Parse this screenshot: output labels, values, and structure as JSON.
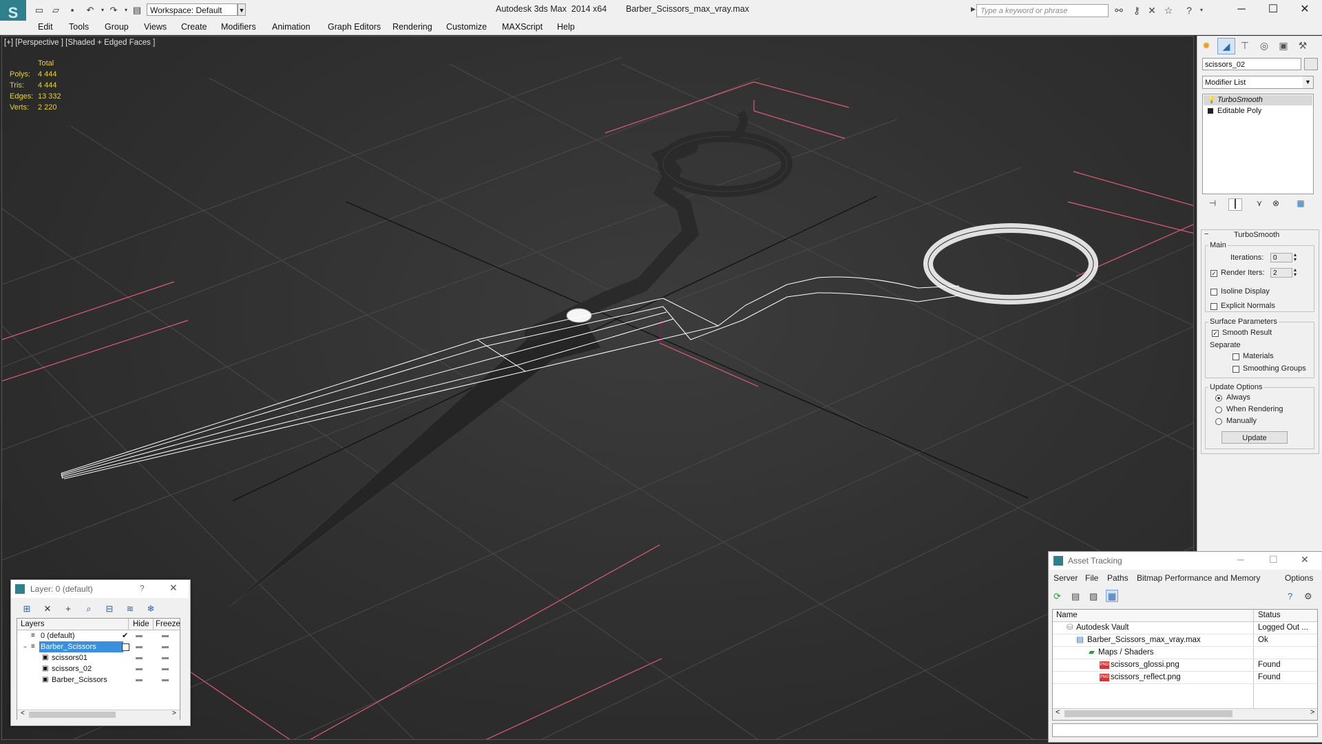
{
  "window": {
    "title_app": "Autodesk 3ds Max  2014 x64",
    "title_file": "Barber_Scissors_max_vray.max",
    "workspace": "Workspace: Default",
    "search_placeholder": "Type a keyword or phrase"
  },
  "menu": [
    "Edit",
    "Tools",
    "Group",
    "Views",
    "Create",
    "Modifiers",
    "Animation",
    "Graph Editors",
    "Rendering",
    "Customize",
    "MAXScript",
    "Help"
  ],
  "viewport": {
    "label": "[+] [Perspective ] [Shaded + Edged Faces ]",
    "stats": {
      "header": "Total",
      "rows": [
        {
          "label": "Polys:",
          "value": "4 444"
        },
        {
          "label": "Tris:",
          "value": "4 444"
        },
        {
          "label": "Edges:",
          "value": "13 332"
        },
        {
          "label": "Verts:",
          "value": "2 220"
        }
      ]
    }
  },
  "command_panel": {
    "object_name": "scissors_02",
    "modifier_list": "Modifier List",
    "stack": [
      "TurboSmooth",
      "Editable Poly"
    ],
    "rollout_title": "TurboSmooth",
    "main_group": "Main",
    "iterations_label": "Iterations:",
    "iterations_value": "0",
    "render_iters_label": "Render Iters:",
    "render_iters_value": "2",
    "isoline_label": "Isoline Display",
    "explicit_normals_label": "Explicit Normals",
    "surface_group": "Surface Parameters",
    "smooth_result_label": "Smooth Result",
    "separate_label": "Separate",
    "materials_label": "Materials",
    "smoothing_groups_label": "Smoothing Groups",
    "update_group": "Update Options",
    "update_options": [
      "Always",
      "When Rendering",
      "Manually"
    ],
    "update_button": "Update"
  },
  "layer_window": {
    "title": "Layer: 0 (default)",
    "help": "?",
    "col_layers": "Layers",
    "col_hide": "Hide",
    "col_freeze": "Freeze",
    "rows": [
      {
        "name": "0 (default)",
        "level": 0
      },
      {
        "name": "Barber_Scissors",
        "level": 0
      },
      {
        "name": "scissors01",
        "level": 1
      },
      {
        "name": "scissors_02",
        "level": 1
      },
      {
        "name": "Barber_Scissors",
        "level": 1
      }
    ]
  },
  "asset_tracking": {
    "title": "Asset Tracking",
    "menu": [
      "Server",
      "File",
      "Paths",
      "Bitmap Performance and Memory",
      "Options"
    ],
    "col_name": "Name",
    "col_status": "Status",
    "rows": [
      {
        "name": "Autodesk Vault",
        "status": "Logged Out ..."
      },
      {
        "name": "Barber_Scissors_max_vray.max",
        "status": "Ok"
      },
      {
        "name": "Maps / Shaders",
        "status": ""
      },
      {
        "name": "scissors_glossi.png",
        "status": "Found"
      },
      {
        "name": "scissors_reflect.png",
        "status": "Found"
      }
    ]
  }
}
